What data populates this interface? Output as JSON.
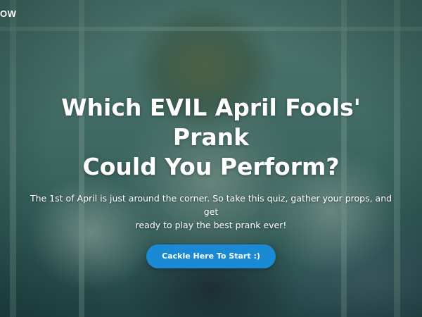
{
  "brand": {
    "partial_text": "OW"
  },
  "hero": {
    "title_line1": "Which EVIL April Fools' Prank",
    "title_line2": "Could You Perform?",
    "subtitle_line1": "The 1st of April is just around the corner. So take this quiz, gather your props, and get",
    "subtitle_line2": "ready to play the best prank ever!",
    "cta_label": "Cackle Here To Start :)"
  },
  "colors": {
    "cta_background": "#1a8ad4",
    "text": "#ffffff",
    "background_tint": "#4f7c74"
  }
}
